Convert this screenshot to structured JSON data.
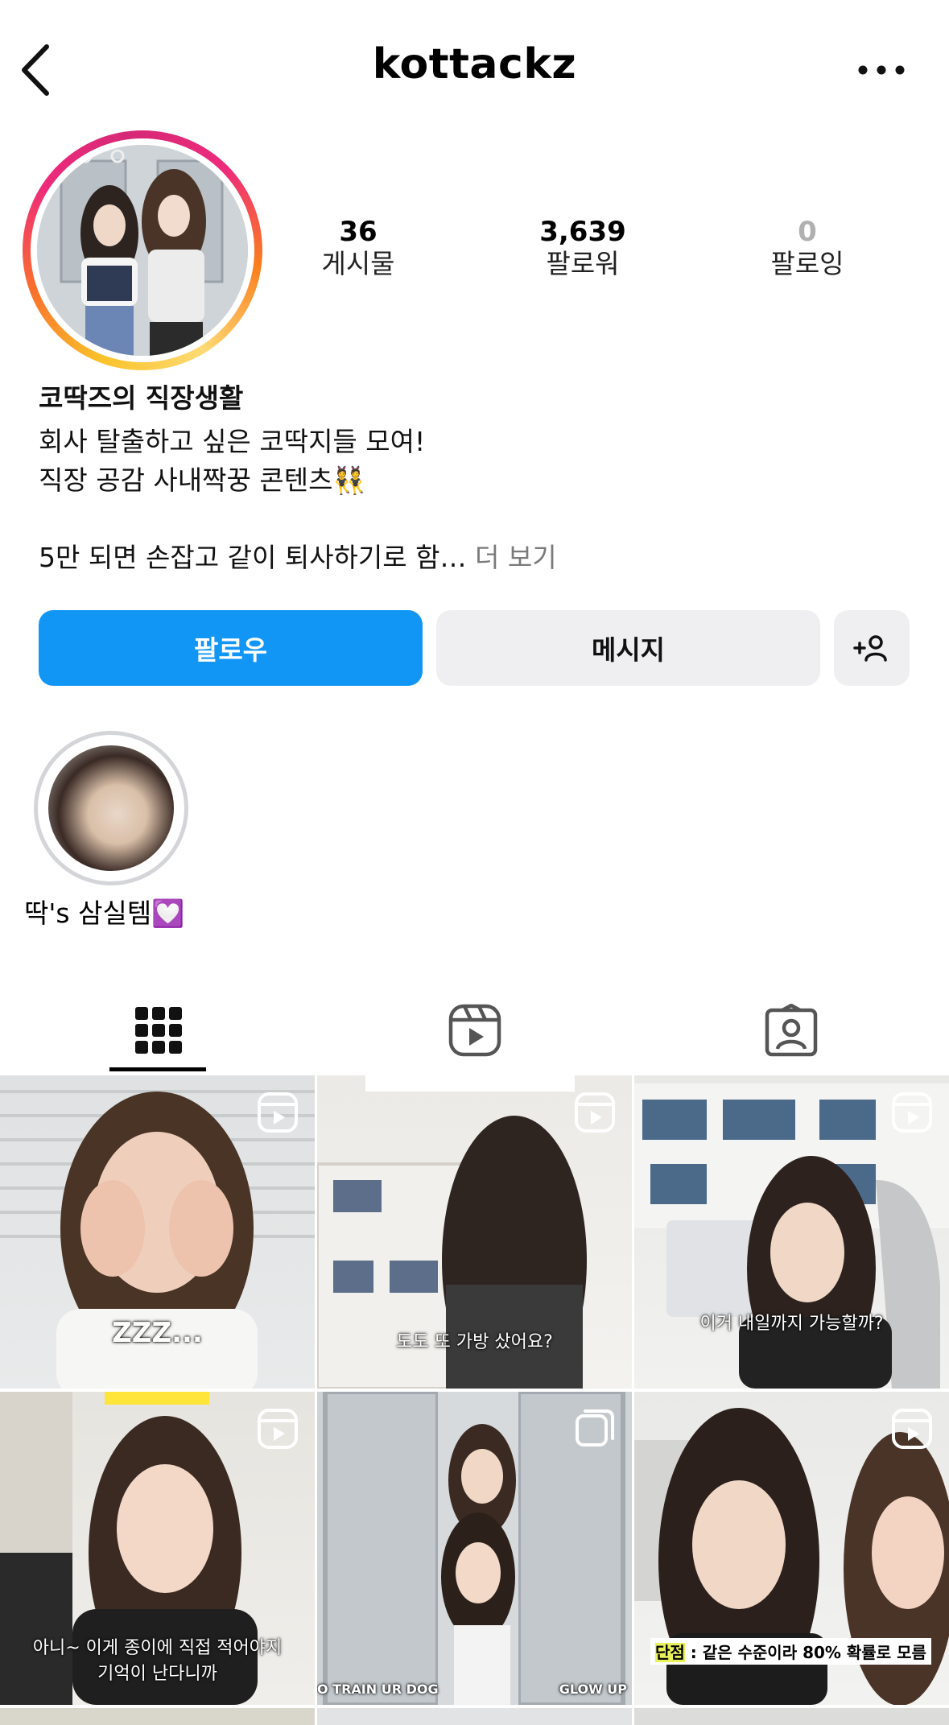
{
  "header": {
    "username": "kottackz",
    "back_icon": "chevron-left-icon",
    "more_icon": "more-horizontal-icon"
  },
  "profile": {
    "stats": [
      {
        "value": "36",
        "label": "게시물"
      },
      {
        "value": "3,639",
        "label": "팔로워"
      },
      {
        "value": "0",
        "label": "팔로잉"
      }
    ],
    "bio": {
      "name": "코딱즈의 직장생활",
      "line1": "회사 탈출하고 싶은 코딱지들 모여!",
      "line2": "직장 공감 사내짝꿍 콘텐츠👯",
      "line3": "5만 되면 손잡고 같이 퇴사하기로 함…",
      "more": "더 보기"
    }
  },
  "actions": {
    "follow": "팔로우",
    "message": "메시지",
    "suggest_icon": "add-person-icon"
  },
  "highlights": [
    {
      "label": "딱's 삼실템💟"
    }
  ],
  "tabs": [
    {
      "name": "grid",
      "icon": "grid-icon",
      "active": true
    },
    {
      "name": "reels",
      "icon": "reels-icon",
      "active": false
    },
    {
      "name": "tagged",
      "icon": "tagged-icon",
      "active": false
    }
  ],
  "posts": [
    {
      "caption": "ZZZ...",
      "type": "reel"
    },
    {
      "caption": "도도 또 가방 샀어요?",
      "type": "reel"
    },
    {
      "caption": "이거 내일까지 가능할까?",
      "type": "reel"
    },
    {
      "caption_line1": "아니~ 이게 종이에 직접 적어야지",
      "caption_line2": "기억이 난다니까",
      "type": "reel"
    },
    {
      "caption_left": "O TRAIN UR DOG",
      "caption_right": "GLOW UP",
      "type": "carousel"
    },
    {
      "caption_tag": "단점",
      "caption": ": 같은 수준이라 80% 확률로 모름",
      "type": "reel"
    }
  ]
}
